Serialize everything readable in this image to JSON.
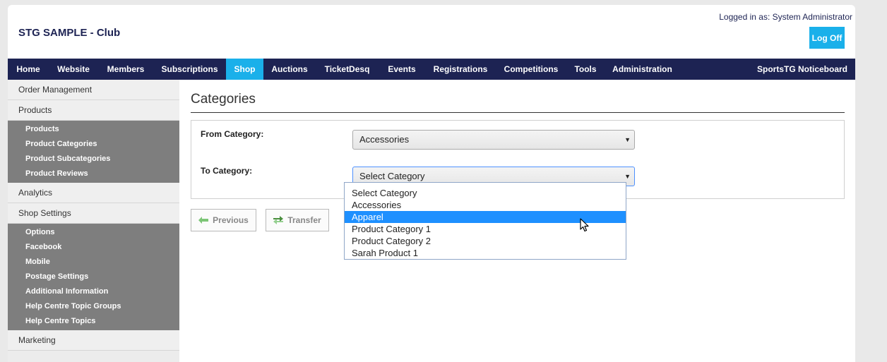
{
  "header": {
    "club_title": "STG SAMPLE - Club",
    "logged_in": "Logged in as: System Administrator",
    "logoff_label": "Log Off"
  },
  "nav": {
    "items": [
      "Home",
      "Website",
      "Members",
      "Subscriptions",
      "Shop",
      "Auctions",
      "TicketDesq",
      "Events",
      "Registrations",
      "Competitions",
      "Tools",
      "Administration"
    ],
    "active": "Shop",
    "right_item": "SportsTG Noticeboard"
  },
  "sidebar": {
    "order_management": "Order Management",
    "products": "Products",
    "products_items": [
      "Products",
      "Product Categories",
      "Product Subcategories",
      "Product Reviews"
    ],
    "analytics": "Analytics",
    "shop_settings": "Shop Settings",
    "shop_settings_items": [
      "Options",
      "Facebook",
      "Mobile",
      "Postage Settings",
      "Additional Information",
      "Help Centre Topic Groups",
      "Help Centre Topics"
    ],
    "marketing": "Marketing"
  },
  "main": {
    "title": "Categories",
    "from_label": "From Category:",
    "from_value": "Accessories",
    "to_label": "To Category:",
    "to_value": "Select Category",
    "previous_label": "Previous",
    "transfer_label": "Transfer"
  },
  "dropdown": {
    "options": [
      "Select Category",
      "Accessories",
      "Apparel",
      "Product Category 1",
      "Product Category 2",
      "Sarah Product 1"
    ],
    "highlighted": "Apparel"
  },
  "colors": {
    "nav_bg": "#1d2353",
    "accent": "#1ab0ea",
    "sidebar_group": "#7e7e7e",
    "highlight": "#1e90ff"
  }
}
